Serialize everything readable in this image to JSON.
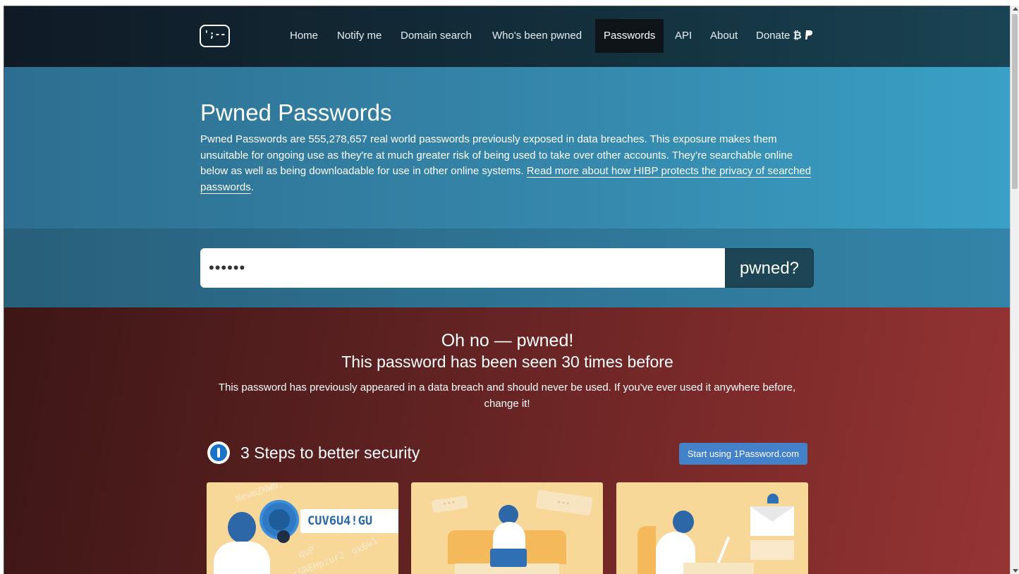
{
  "nav": {
    "logo_text": "';--",
    "items": [
      {
        "label": "Home"
      },
      {
        "label": "Notify me"
      },
      {
        "label": "Domain search"
      },
      {
        "label": "Who's been pwned"
      },
      {
        "label": "Passwords",
        "active": true
      },
      {
        "label": "API"
      },
      {
        "label": "About"
      },
      {
        "label": "Donate"
      }
    ],
    "donate_icons": "₿",
    "donate_icon_names": [
      "bitcoin-icon",
      "paypal-icon"
    ]
  },
  "hero": {
    "title": "Pwned Passwords",
    "description": "Pwned Passwords are 555,278,657 real world passwords previously exposed in data breaches. This exposure makes them unsuitable for ongoing use as they're at much greater risk of being used to take over other accounts. They're searchable online below as well as being downloadable for use in other online systems. ",
    "link_text": "Read more about how HIBP protects the privacy of searched passwords",
    "trailing": "."
  },
  "search": {
    "value": "••••••",
    "button_label": "pwned?"
  },
  "result": {
    "heading": "Oh no — pwned!",
    "subheading": "This password has been seen 30 times before",
    "text": "This password has previously appeared in a data breach and should never be used. If you've ever used it anywhere before, change it!"
  },
  "steps": {
    "title": "3 Steps to better security",
    "button_label": "Start using 1Password.com",
    "card1_code": "CUV6U4!GU",
    "card1_ring": "NewmZNWN,",
    "card1_ring2": "sSREHpzur2",
    "card1_ring3": "9k6w1",
    "card1_ring4": "quP",
    "bubble_text": "•••",
    "brand_color": "#4381c9",
    "alert_color": "#7c2a2a"
  }
}
